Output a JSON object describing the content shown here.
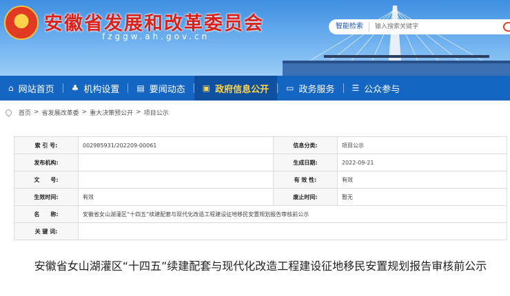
{
  "header": {
    "site_title": "安徽省发展和改革委员会",
    "site_url": "fzggw.ah.gov.cn",
    "search_label": "智能检索",
    "search_placeholder": "输入搜索关键字"
  },
  "nav": {
    "items": [
      {
        "label": "网站首页",
        "icon": "home-icon"
      },
      {
        "label": "机构设置",
        "icon": "org-icon"
      },
      {
        "label": "要闻动态",
        "icon": "news-icon"
      },
      {
        "label": "政府信息公开",
        "icon": "info-icon"
      },
      {
        "label": "政务服务",
        "icon": "service-icon"
      },
      {
        "label": "公众参与",
        "icon": "participate-icon"
      }
    ],
    "active": "政府信息公开"
  },
  "breadcrumb": [
    "首页",
    "省发展改革委",
    "重大决策预公开",
    "项目公示"
  ],
  "meta": {
    "index_label": "索 引 号:",
    "index_value": "002985931/202209-00061",
    "category_label": "信息分类:",
    "category_value": "项目公示",
    "publisher_label": "发布机构:",
    "publisher_value": "",
    "date_label": "生成日期:",
    "date_value": "2022-09-21",
    "docno_label": "文　　号:",
    "docno_value": "",
    "validity_label": "有 效 性:",
    "validity_value": "有效",
    "effective_label": "生效时间:",
    "effective_value": "有效",
    "repeal_label": "废止时间:",
    "repeal_value": "暂无",
    "name_label": "名　　称:",
    "name_value": "安徽省女山湖灌区“十四五”续建配套与现代化改造工程建设征地移民安置规划报告审核前公示",
    "keywords_label": "关 键 词:",
    "keywords_value": ""
  },
  "article": {
    "title": "安徽省女山湖灌区“十四五”续建配套与现代化改造工程建设征地移民安置规划报告审核前公示"
  }
}
